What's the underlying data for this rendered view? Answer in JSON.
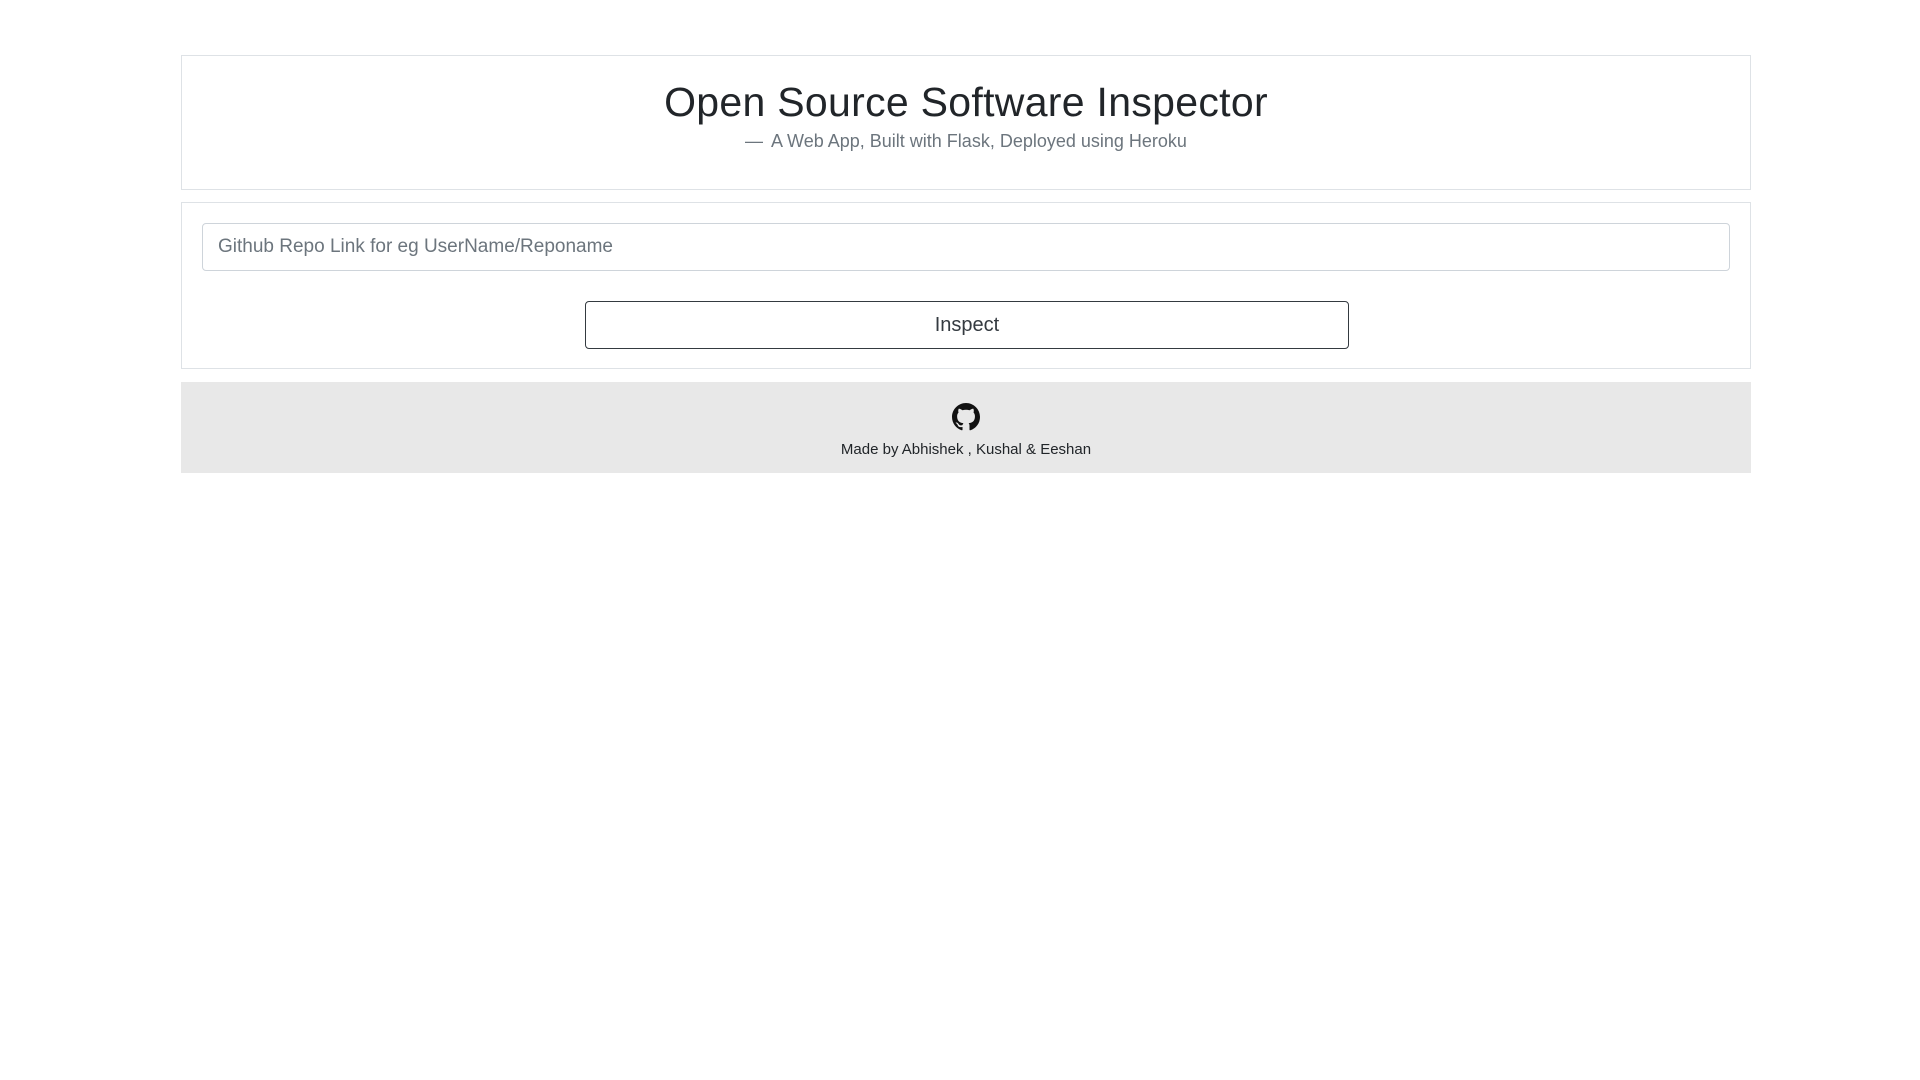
{
  "header": {
    "title": "Open Source Software Inspector",
    "subtitle_dash": "—",
    "subtitle": "A Web App, Built with Flask, Deployed using Heroku"
  },
  "form": {
    "repo_input_placeholder": "Github Repo Link for eg UserName/Reponame",
    "repo_input_value": "",
    "inspect_label": "Inspect"
  },
  "footer": {
    "icon": "github-icon",
    "credit": "Made by Abhishek , Kushal & Eeshan"
  },
  "colors": {
    "footer_background": "#e8e8e8",
    "border": "#dee2e6",
    "button_border": "#343a40",
    "muted_text": "#6c757d"
  }
}
